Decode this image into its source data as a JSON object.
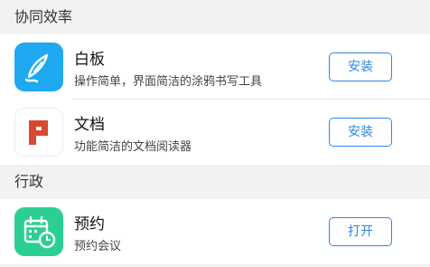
{
  "sections": [
    {
      "title": "协同效率",
      "apps": [
        {
          "icon": "whiteboard-pen-icon",
          "icon_color": "#1ea9f0",
          "name": "白板",
          "description": "操作简单，界面简洁的涂鸦书写工具",
          "action": "安装"
        },
        {
          "icon": "document-p-icon",
          "icon_color": "#d64a2f",
          "name": "文档",
          "description": "功能简洁的文档阅读器",
          "action": "安装"
        }
      ]
    },
    {
      "title": "行政",
      "apps": [
        {
          "icon": "calendar-clock-icon",
          "icon_color": "#2ccf93",
          "name": "预约",
          "description": "预约会议",
          "action": "打开"
        }
      ]
    }
  ],
  "colors": {
    "accent": "#2f86e6",
    "background": "#f2f2f4"
  }
}
